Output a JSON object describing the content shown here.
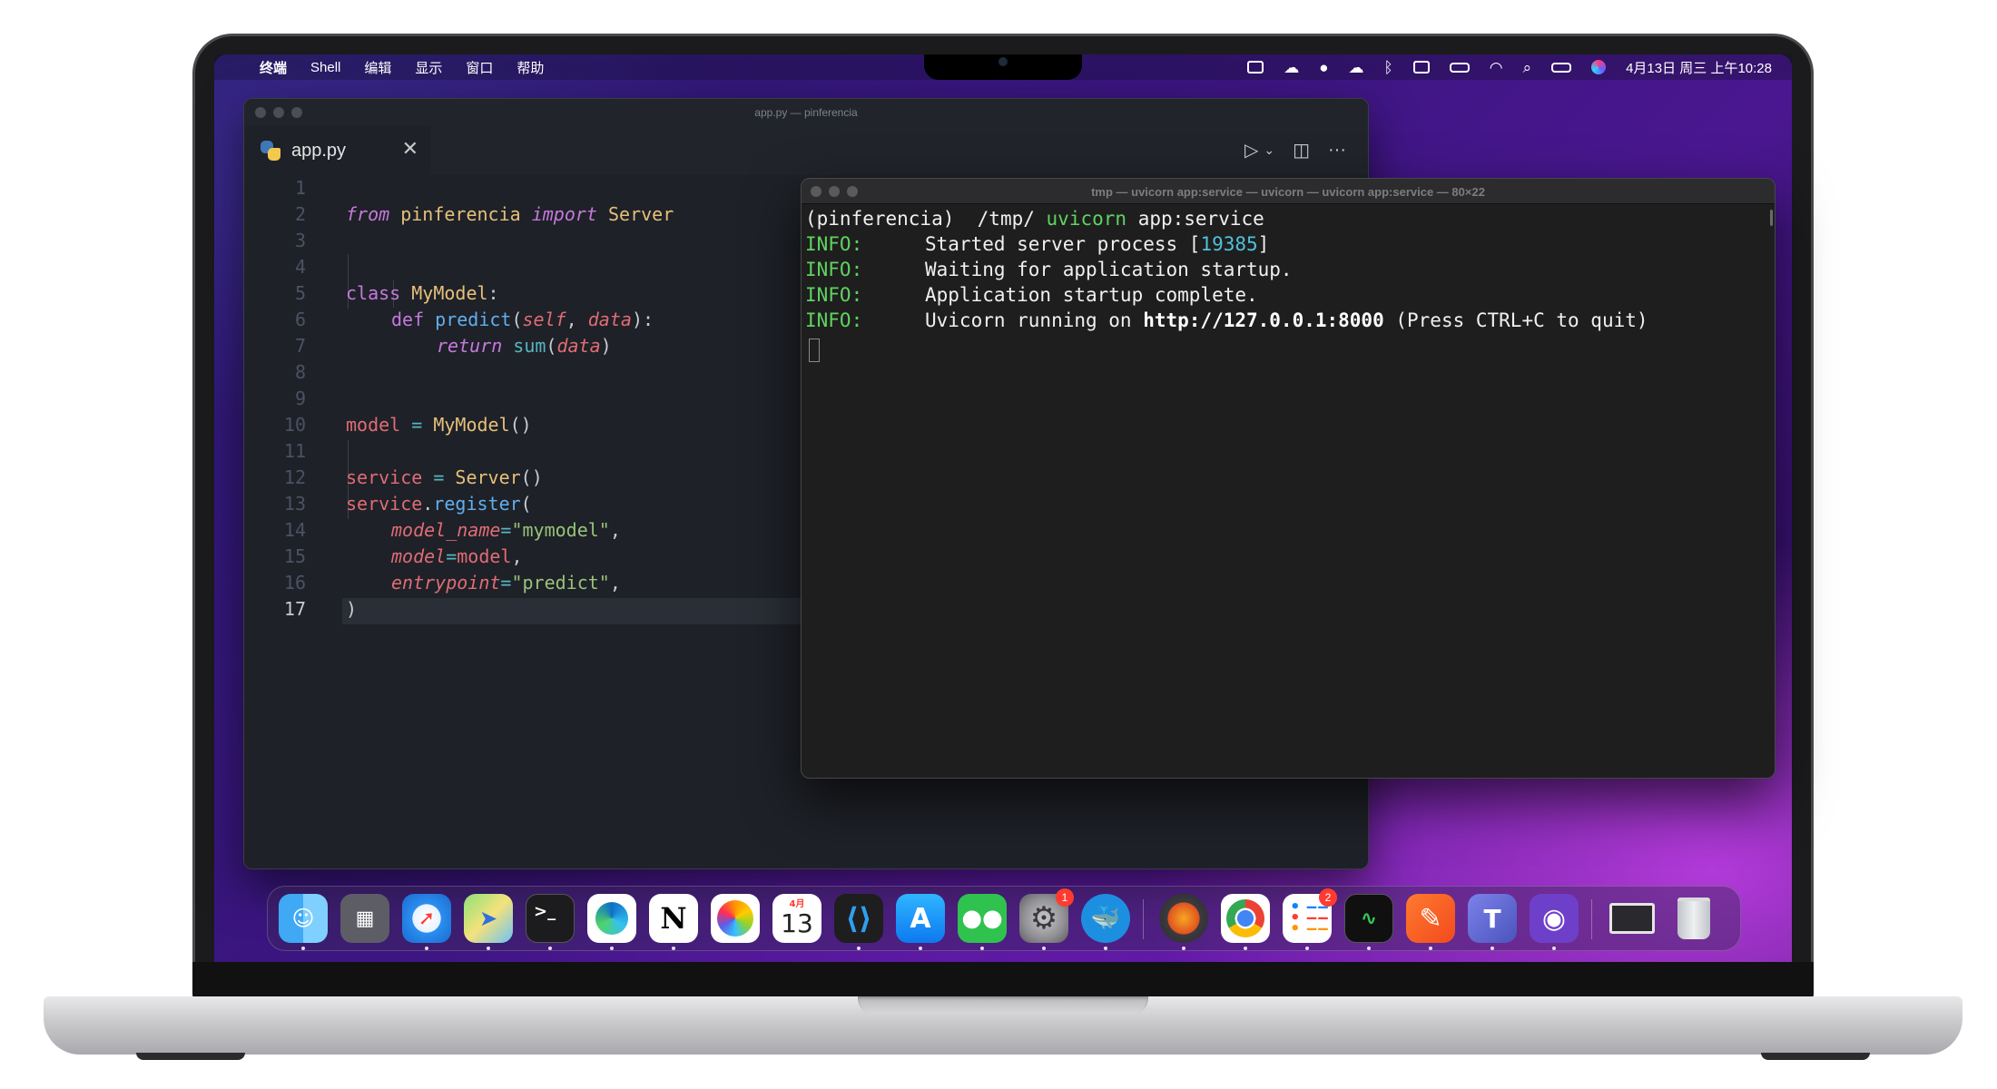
{
  "menubar": {
    "apple": "",
    "app_name": "终端",
    "items": [
      "Shell",
      "编辑",
      "显示",
      "窗口",
      "帮助"
    ],
    "clock": "4月13日 周三 上午10:28",
    "tray_icons": [
      "photo-icon",
      "cloud-icon",
      "wechat-icon",
      "cloud-sync-icon",
      "bluetooth-icon",
      "keyboard-icon",
      "battery-icon",
      "wifi-icon",
      "search-icon",
      "control-center-icon",
      "siri-icon"
    ]
  },
  "vscode": {
    "window_title": "app.py — pinferencia",
    "tab_label": "app.py",
    "tab_close": "✕",
    "actions": {
      "run": "▷",
      "run_menu": "⌄",
      "split": "◫",
      "more": "···"
    },
    "line_numbers": [
      "1",
      "2",
      "3",
      "4",
      "5",
      "6",
      "7",
      "8",
      "9",
      "10",
      "11",
      "12",
      "13",
      "14",
      "15",
      "16",
      "17"
    ],
    "code": {
      "l1_from": "from",
      "l1_mod": " pinferencia ",
      "l1_import": "import",
      "l1_cls": " Server",
      "l4_class": "class",
      "l4_name": " MyModel",
      "l4_colon": ":",
      "l5_def": "def",
      "l5_fn": " predict",
      "l5_open": "(",
      "l5_self": "self",
      "l5_comma": ", ",
      "l5_data": "data",
      "l5_close": "):",
      "l6_return": "return",
      "l6_fn": " sum",
      "l6_open": "(",
      "l6_data": "data",
      "l6_close": ")",
      "l9_var": "model",
      "l9_eq": " = ",
      "l9_cls": "MyModel",
      "l9_paren": "()",
      "l11_var": "service",
      "l11_eq": " = ",
      "l11_cls": "Server",
      "l11_paren": "()",
      "l12_var": "service",
      "l12_dot": ".",
      "l12_fn": "register",
      "l12_open": "(",
      "l13_kw": "model_name",
      "l13_eq": "=",
      "l13_str": "\"mymodel\"",
      "l13_comma": ",",
      "l14_kw": "model",
      "l14_eq": "=",
      "l14_val": "model",
      "l14_comma": ",",
      "l15_kw": "entrypoint",
      "l15_eq": "=",
      "l15_str": "\"predict\"",
      "l15_comma": ",",
      "l16_close": ")"
    }
  },
  "terminal": {
    "window_title": "tmp — uvicorn app:service — uvicorn — uvicorn app:service — 80×22",
    "prompt_env": "(pinferencia) ",
    "prompt_apple": "",
    "prompt_path": " /tmp/ ",
    "prompt_cmd": "uvicorn",
    "prompt_args": " app:service",
    "info_label": "INFO:",
    "log1_text": "Started server process [",
    "log1_pid": "19385",
    "log1_end": "]",
    "log2_text": "Waiting for application startup.",
    "log3_text": "Application startup complete.",
    "log4_pre": "Uvicorn running on ",
    "log4_url": "http://127.0.0.1:8000",
    "log4_post": " (Press CTRL+C to quit)"
  },
  "dock": {
    "apps": [
      "Finder",
      "Launchpad",
      "Safari",
      "Maps",
      "Terminal",
      "Edge",
      "Notion",
      "Photos",
      "Calendar",
      "VS Code",
      "App Store",
      "WeChat",
      "System Preferences",
      "Docker",
      "Postman",
      "Chrome",
      "Reminders",
      "Activity Monitor",
      "Paw",
      "Teams",
      "GitHub Desktop",
      "Screen",
      "Trash"
    ],
    "calendar_month": "4月",
    "calendar_day": "13",
    "notion_letter": "N",
    "terminal_glyph": ">_",
    "badge_settings": "1",
    "badge_reminders": "2"
  }
}
